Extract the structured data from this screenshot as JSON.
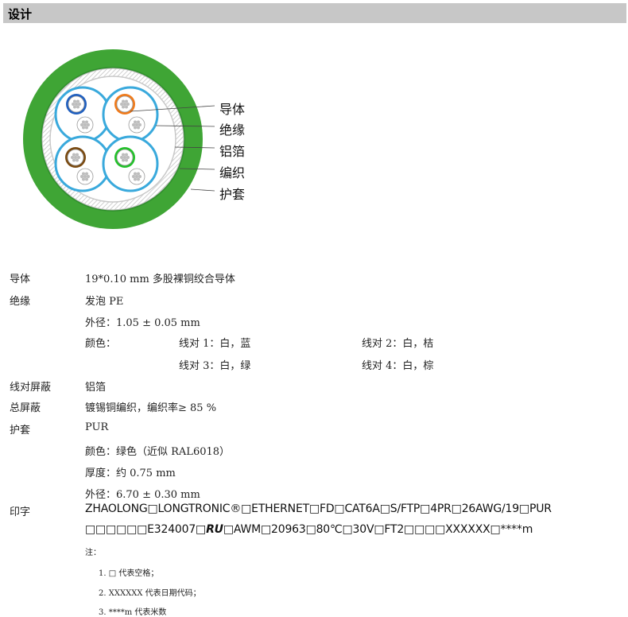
{
  "header": {
    "title": "设计"
  },
  "legend": {
    "conductor": "导体",
    "insulation": "绝缘",
    "foil": "铝箔",
    "braid": "编织",
    "jacket": "护套"
  },
  "colors": {
    "header_bg": "#c7c7c7",
    "jacket_green": "#3fa535",
    "pair_ring_blue": "#39a9dc",
    "core_blue": "#1f5fbf",
    "core_orange": "#f07a1a",
    "core_brown": "#7a4a10",
    "core_green": "#22c12a"
  },
  "specs": {
    "conductor": {
      "label": "导体",
      "value": "19*0.10 mm 多股裸铜绞合导体"
    },
    "insulation": {
      "label": "绝缘",
      "value": "发泡 PE",
      "od": "外径：1.05 ± 0.05 mm",
      "color_label": "颜色：",
      "pairs": [
        "线对 1：白，蓝",
        "线对 2：白，桔",
        "线对 3：白，绿",
        "线对 4：白，棕"
      ]
    },
    "pair_shield": {
      "label": "线对屏蔽",
      "value": "铝箔"
    },
    "overall_shield": {
      "label": "总屏蔽",
      "value": "镀锡铜编织，编织率≥ 85 %"
    },
    "jacket": {
      "label": "护套",
      "value": "PUR",
      "color": "颜色：绿色（近似 RAL6018）",
      "thickness": "厚度：约 0.75 mm",
      "od": "外径：6.70 ± 0.30 mm"
    },
    "marking": {
      "label": "印字",
      "line1": "ZHAOLONG□LONGTRONIC®□ETHERNET□FD□CAT6A□S/FTP□4PR□26AWG/19□PUR",
      "line2_a": "□□□□□□E324007□",
      "logo": "RU",
      "line2_b": "□AWM□20963□80℃□30V□FT2□□□□XXXXXX□****m"
    }
  },
  "notes": {
    "title": "注：",
    "items": [
      "1.  □ 代表空格；",
      "2.  XXXXXX 代表日期代码；",
      "3.  ****m 代表米数"
    ]
  }
}
